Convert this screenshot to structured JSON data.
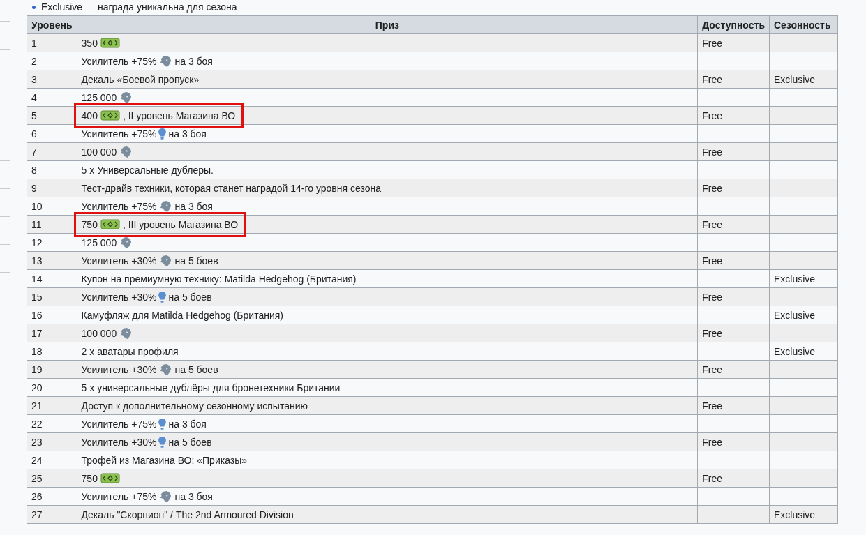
{
  "legend_item": "Exclusive — награда уникальна для сезона",
  "table": {
    "columns": [
      "Уровень",
      "Приз",
      "Доступность",
      "Сезонность"
    ],
    "rows": [
      {
        "level": "1",
        "prize": [
          {
            "kind": "text",
            "text": "350"
          },
          {
            "kind": "bonds"
          }
        ],
        "availability": "Free",
        "season": "",
        "highlighted": false
      },
      {
        "level": "2",
        "prize": [
          {
            "kind": "text",
            "text": "Усилитель +75%"
          },
          {
            "kind": "credits"
          },
          {
            "kind": "text",
            "text": "на 3 боя"
          }
        ],
        "availability": "",
        "season": "",
        "highlighted": false
      },
      {
        "level": "3",
        "prize": [
          {
            "kind": "text",
            "text": "Декаль «Боевой пропуск»"
          }
        ],
        "availability": "Free",
        "season": "Exclusive",
        "highlighted": false
      },
      {
        "level": "4",
        "prize": [
          {
            "kind": "text",
            "text": "125 000"
          },
          {
            "kind": "credits"
          }
        ],
        "availability": "",
        "season": "",
        "highlighted": false
      },
      {
        "level": "5",
        "prize": [
          {
            "kind": "text",
            "text": "400"
          },
          {
            "kind": "bonds"
          },
          {
            "kind": "text",
            "text": ", II уровень Магазина ВО"
          }
        ],
        "availability": "Free",
        "season": "",
        "highlighted": true
      },
      {
        "level": "6",
        "prize": [
          {
            "kind": "text",
            "text": "Усилитель +75%"
          },
          {
            "kind": "xp"
          },
          {
            "kind": "text",
            "text": "на 3 боя"
          }
        ],
        "availability": "",
        "season": "",
        "highlighted": false
      },
      {
        "level": "7",
        "prize": [
          {
            "kind": "text",
            "text": "100 000"
          },
          {
            "kind": "credits"
          }
        ],
        "availability": "Free",
        "season": "",
        "highlighted": false
      },
      {
        "level": "8",
        "prize": [
          {
            "kind": "text",
            "text": "5 x Универсальные дублеры."
          }
        ],
        "availability": "",
        "season": "",
        "highlighted": false
      },
      {
        "level": "9",
        "prize": [
          {
            "kind": "text",
            "text": "Тест-драйв техники, которая станет наградой 14-го уровня сезона"
          }
        ],
        "availability": "Free",
        "season": "",
        "highlighted": false
      },
      {
        "level": "10",
        "prize": [
          {
            "kind": "text",
            "text": "Усилитель +75%"
          },
          {
            "kind": "credits"
          },
          {
            "kind": "text",
            "text": "на 3 боя"
          }
        ],
        "availability": "",
        "season": "",
        "highlighted": false
      },
      {
        "level": "11",
        "prize": [
          {
            "kind": "text",
            "text": "750"
          },
          {
            "kind": "bonds"
          },
          {
            "kind": "text",
            "text": ", III уровень Магазина ВО"
          }
        ],
        "availability": "Free",
        "season": "",
        "highlighted": true
      },
      {
        "level": "12",
        "prize": [
          {
            "kind": "text",
            "text": "125 000"
          },
          {
            "kind": "credits"
          }
        ],
        "availability": "",
        "season": "",
        "highlighted": false
      },
      {
        "level": "13",
        "prize": [
          {
            "kind": "text",
            "text": "Усилитель +30%"
          },
          {
            "kind": "credits"
          },
          {
            "kind": "text",
            "text": "на 5 боев"
          }
        ],
        "availability": "Free",
        "season": "",
        "highlighted": false
      },
      {
        "level": "14",
        "prize": [
          {
            "kind": "text",
            "text": "Купон на премиумную технику: Matilda Hedgehog (Британия)"
          }
        ],
        "availability": "",
        "season": "Exclusive",
        "highlighted": false
      },
      {
        "level": "15",
        "prize": [
          {
            "kind": "text",
            "text": "Усилитель +30%"
          },
          {
            "kind": "xp"
          },
          {
            "kind": "text",
            "text": "на 5 боев"
          }
        ],
        "availability": "Free",
        "season": "",
        "highlighted": false
      },
      {
        "level": "16",
        "prize": [
          {
            "kind": "text",
            "text": "Камуфляж для Matilda Hedgehog (Британия)"
          }
        ],
        "availability": "",
        "season": "Exclusive",
        "highlighted": false
      },
      {
        "level": "17",
        "prize": [
          {
            "kind": "text",
            "text": "100 000"
          },
          {
            "kind": "credits"
          }
        ],
        "availability": "Free",
        "season": "",
        "highlighted": false
      },
      {
        "level": "18",
        "prize": [
          {
            "kind": "text",
            "text": "2 x аватары профиля"
          }
        ],
        "availability": "",
        "season": "Exclusive",
        "highlighted": false
      },
      {
        "level": "19",
        "prize": [
          {
            "kind": "text",
            "text": "Усилитель +30%"
          },
          {
            "kind": "credits"
          },
          {
            "kind": "text",
            "text": "на 5 боев"
          }
        ],
        "availability": "Free",
        "season": "",
        "highlighted": false
      },
      {
        "level": "20",
        "prize": [
          {
            "kind": "text",
            "text": "5 x универсальные дублёры для бронетехники Британии"
          }
        ],
        "availability": "",
        "season": "",
        "highlighted": false
      },
      {
        "level": "21",
        "prize": [
          {
            "kind": "text",
            "text": "Доступ к дополнительному сезонному испытанию"
          }
        ],
        "availability": "Free",
        "season": "",
        "highlighted": false
      },
      {
        "level": "22",
        "prize": [
          {
            "kind": "text",
            "text": "Усилитель +75%"
          },
          {
            "kind": "xp"
          },
          {
            "kind": "text",
            "text": "на 3 боя"
          }
        ],
        "availability": "",
        "season": "",
        "highlighted": false
      },
      {
        "level": "23",
        "prize": [
          {
            "kind": "text",
            "text": "Усилитель +30%"
          },
          {
            "kind": "xp"
          },
          {
            "kind": "text",
            "text": "на 5 боев"
          }
        ],
        "availability": "Free",
        "season": "",
        "highlighted": false
      },
      {
        "level": "24",
        "prize": [
          {
            "kind": "text",
            "text": "Трофей из Магазина ВО: «Приказы»"
          }
        ],
        "availability": "",
        "season": "",
        "highlighted": false
      },
      {
        "level": "25",
        "prize": [
          {
            "kind": "text",
            "text": "750"
          },
          {
            "kind": "bonds"
          }
        ],
        "availability": "Free",
        "season": "",
        "highlighted": false
      },
      {
        "level": "26",
        "prize": [
          {
            "kind": "text",
            "text": "Усилитель +75%"
          },
          {
            "kind": "credits"
          },
          {
            "kind": "text",
            "text": "на 3 боя"
          }
        ],
        "availability": "",
        "season": "",
        "highlighted": false
      },
      {
        "level": "27",
        "prize": [
          {
            "kind": "text",
            "text": "Декаль \"Скорпион\" / The 2nd Armoured Division"
          }
        ],
        "availability": "",
        "season": "Exclusive",
        "highlighted": false
      }
    ]
  }
}
